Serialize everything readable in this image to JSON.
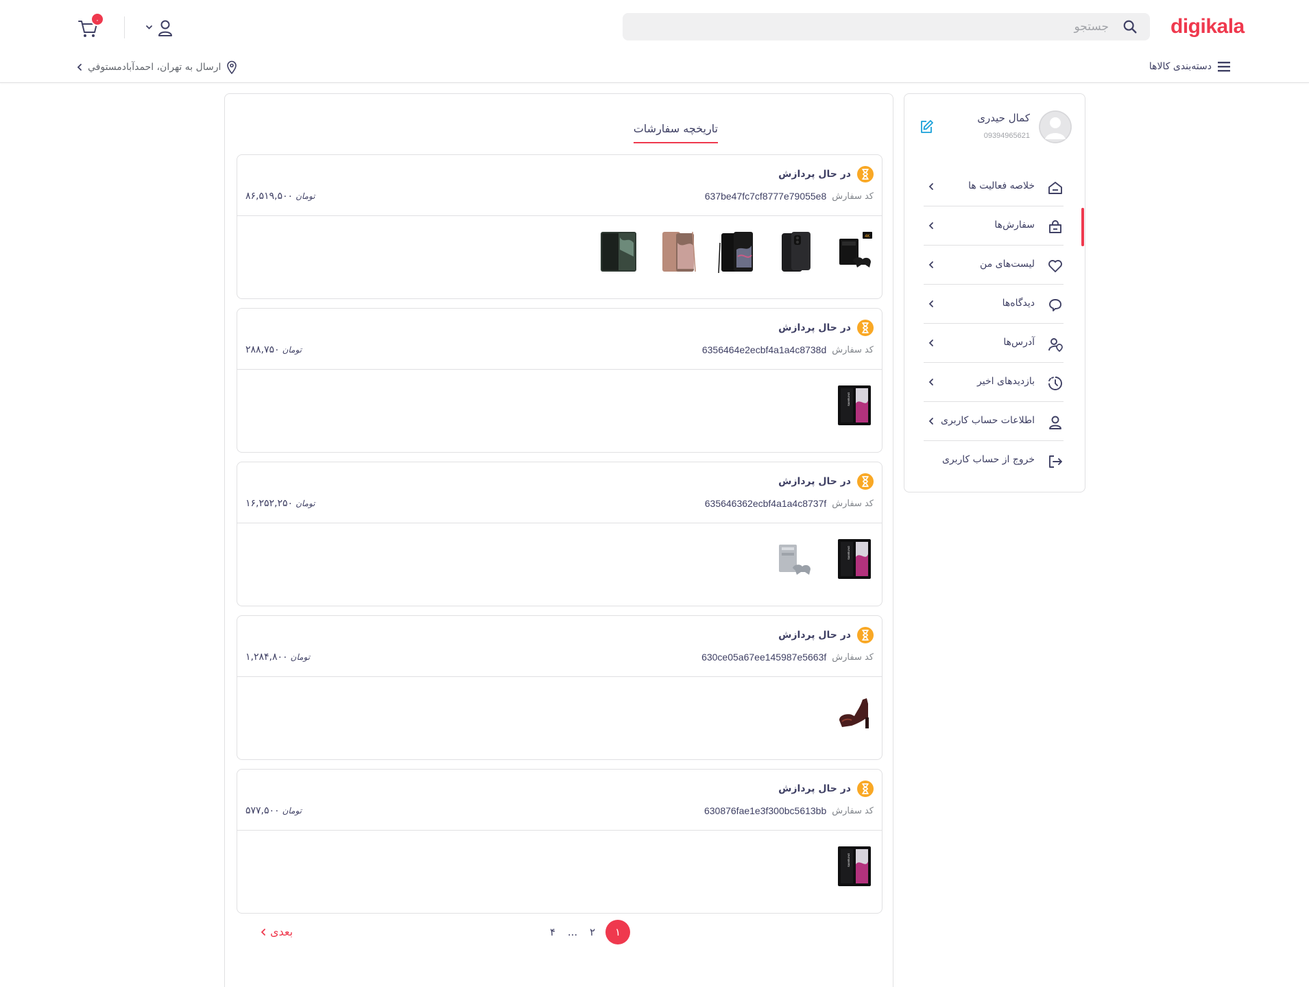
{
  "brand": {
    "logo": "digikala",
    "accent": "#ef394e"
  },
  "header": {
    "search_placeholder": "جستجو",
    "cart_count": "۰",
    "categories_label": "دسته‌بندی کالاها",
    "shipping_text": "ارسال به تهران، احمدآبادمستوفي"
  },
  "profile": {
    "name": "کمال حیدری",
    "phone": "09394965621"
  },
  "menu": [
    {
      "label": "خلاصه فعالیت ها",
      "icon": "home-icon"
    },
    {
      "label": "سفارش‌ها",
      "icon": "bag-icon",
      "active": true
    },
    {
      "label": "لیست‌های من",
      "icon": "heart-icon"
    },
    {
      "label": "دیدگاه‌ها",
      "icon": "comment-icon"
    },
    {
      "label": "آدرس‌ها",
      "icon": "location-user-icon"
    },
    {
      "label": "بازدیدهای اخیر",
      "icon": "clock-icon"
    },
    {
      "label": "اطلاعات حساب کاربری",
      "icon": "user-icon"
    },
    {
      "label": "خروج از حساب کاربری",
      "icon": "logout-icon"
    }
  ],
  "orders_tab": "تاریخچه سفارشات",
  "order_code_label": "کد سفارش",
  "currency": "تومان",
  "orders": [
    {
      "status": "در حال پردازش",
      "code": "637be47fc7cf8777e79055e8",
      "price": "۸۶,۵۱۹,۵۰۰",
      "items": [
        "playstation-console",
        "samsung-galaxy-a12",
        "samsung-galaxy-s22-ultra",
        "samsung-galaxy-note20",
        "samsung-galaxy-z-fold"
      ]
    },
    {
      "status": "در حال پردازش",
      "code": "6356464e2ecbf4a1a4c8738d",
      "price": "۲۸۸,۷۵۰",
      "items": [
        "samsung-galaxy-a53"
      ]
    },
    {
      "status": "در حال پردازش",
      "code": "635646362ecbf4a1a4c8737f",
      "price": "۱۶,۲۵۲,۲۵۰",
      "items": [
        "samsung-galaxy-a53",
        "playstation-console-silver"
      ]
    },
    {
      "status": "در حال پردازش",
      "code": "630ce05a67ee145987e5663f",
      "price": "۱,۲۸۴,۸۰۰",
      "items": [
        "platform-heel-shoe"
      ]
    },
    {
      "status": "در حال پردازش",
      "code": "630876fae1e3f300bc5613bb",
      "price": "۵۷۷,۵۰۰",
      "items": [
        "samsung-galaxy-a53"
      ]
    }
  ],
  "pagination": {
    "pages": [
      "۱",
      "۲",
      "...",
      "۴"
    ],
    "current": "۱",
    "next_label": "بعدی"
  },
  "colors": {
    "status_processing": "#f9a825",
    "text": "#3f4064",
    "muted": "#a1a3a8"
  }
}
